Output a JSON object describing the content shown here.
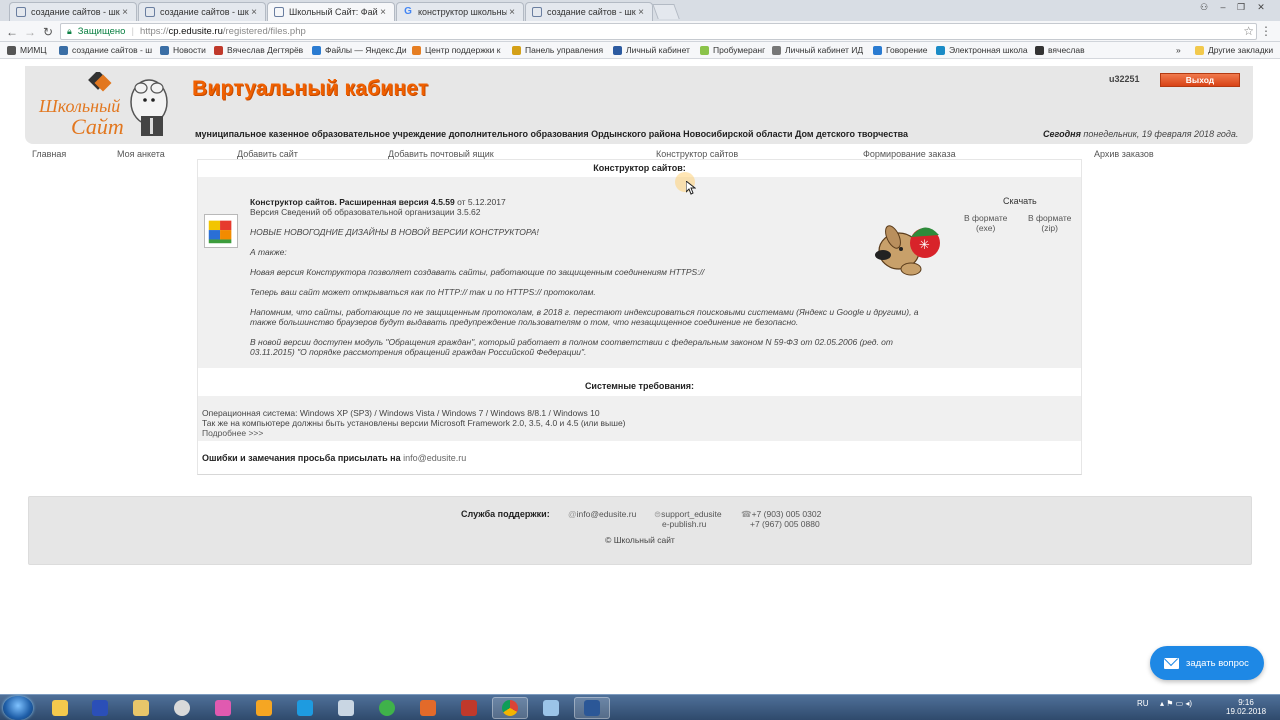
{
  "browser": {
    "tabs": [
      {
        "label": "создание сайтов - школ"
      },
      {
        "label": "создание сайтов - школ"
      },
      {
        "label": "Школьный Сайт: Файлы"
      },
      {
        "label": "конструктор школьных"
      },
      {
        "label": "создание сайтов - школ"
      }
    ],
    "secure_label": "Защищено",
    "url_scheme": "https://",
    "url_host": "cp.edusite.ru",
    "url_path": "/registered/files.php",
    "bookmarks": [
      {
        "label": "МИМЦ",
        "color": "#555555"
      },
      {
        "label": "создание сайтов - ш",
        "color": "#3a6ea5"
      },
      {
        "label": "Новости",
        "color": "#3a6ea5"
      },
      {
        "label": "Вячеслав Дегтярёв",
        "color": "#c0392b"
      },
      {
        "label": "Файлы — Яндекс.Ди",
        "color": "#2a7bd1"
      },
      {
        "label": "Центр поддержки к",
        "color": "#e67e22"
      },
      {
        "label": "Панель управления",
        "color": "#d4a017"
      },
      {
        "label": "Личный кабинет",
        "color": "#2c5aa0"
      },
      {
        "label": "Пробумеранг",
        "color": "#8bc34a"
      },
      {
        "label": "Личный кабинет ИД",
        "color": "#777777"
      },
      {
        "label": "Говорение",
        "color": "#2a7bd1"
      },
      {
        "label": "Электронная школа",
        "color": "#1a8bc6"
      },
      {
        "label": "вячеслав",
        "color": "#333333"
      }
    ],
    "other_bookmarks": "Другие закладки",
    "overflow": "»"
  },
  "header": {
    "title": "Виртуальный кабинет",
    "org_name": "муниципальное казенное образовательное учреждение дополнительного образования Ордынского района Новосибирской области Дом детского творчества",
    "user_id": "u32251",
    "logout_label": "Выход",
    "date_prefix": "Сегодня",
    "date_text": "понедельник, 19 февраля 2018 года."
  },
  "nav": {
    "items": [
      {
        "label": "Главная"
      },
      {
        "label": "Моя анкета"
      },
      {
        "label": "Добавить сайт"
      },
      {
        "label": "Добавить почтовый ящик"
      },
      {
        "label": "Конструктор сайтов"
      },
      {
        "label": "Формирование заказа"
      },
      {
        "label": "Архив заказов"
      }
    ]
  },
  "constructor": {
    "heading": "Конструктор сайтов:",
    "download_heading": "Скачать",
    "product_title": "Конструктор сайтов. Расширенная версия 4.5.59",
    "product_date": " от 5.12.2017",
    "product_sub": "Версия Сведений об образовательной организации 3.5.62",
    "news": "НОВЫЕ НОВОГОДНИЕ ДИЗАЙНЫ В НОВОЙ ВЕРСИИ КОНСТРУКТОРА!",
    "also": "А также:",
    "p1": "Новая версия Конструктора позволяет создавать сайты, работающие по защищенным соединениям HTTPS://",
    "p2": "Теперь ваш сайт может открываться как по HTTP:// так и по HTTPS:// протоколам.",
    "p3a": "Напомним, что сайты, работающие по не защищенным протоколам, в 2018 г. перестают индексироваться поисковыми системами (Яндекс и Google и другими), а",
    "p3b": "также большинство браузеров будут выдавать предупреждение пользователям о том, что незащищенное соединение не безопасно.",
    "p4a": "В новой версии доступен модуль \"Обращения граждан\", который работает в полном соответствии с федеральным законом N 59-ФЗ от 02.05.2006 (ред. от",
    "p4b": "03.11.2015) \"О порядке рассмотрения обращений граждан Российской Федерации\".",
    "dl_exe_1": "В формате",
    "dl_exe_2": "(exe)",
    "dl_zip_1": "В формате",
    "dl_zip_2": "(zip)"
  },
  "requirements": {
    "heading": "Системные требования:",
    "os": "Операционная система: Windows XP (SP3) / Windows Vista / Windows 7 / Windows 8/8.1 / Windows 10",
    "framework": "Так же на компьютере должны быть установлены версии Microsoft Framework 2.0, 3.5, 4.0 и 4.5 (или выше)",
    "more": "Подробнее >>>"
  },
  "errors": {
    "label": "Ошибки и замечания просьба присылать на",
    "email": "info@edusite.ru"
  },
  "footer": {
    "support_label": "Служба поддержки:",
    "email": "info@edusite.ru",
    "skype": "support_edusite",
    "skype_domain": "e-publish.ru",
    "phone1": "+7 (903) 005 0302",
    "phone2": "+7 (967) 005 0880",
    "copyright": "© Школьный сайт"
  },
  "ask_button": "задать вопрос",
  "taskbar": {
    "lang": "RU",
    "time": "9:16",
    "date": "19.02.2018"
  }
}
